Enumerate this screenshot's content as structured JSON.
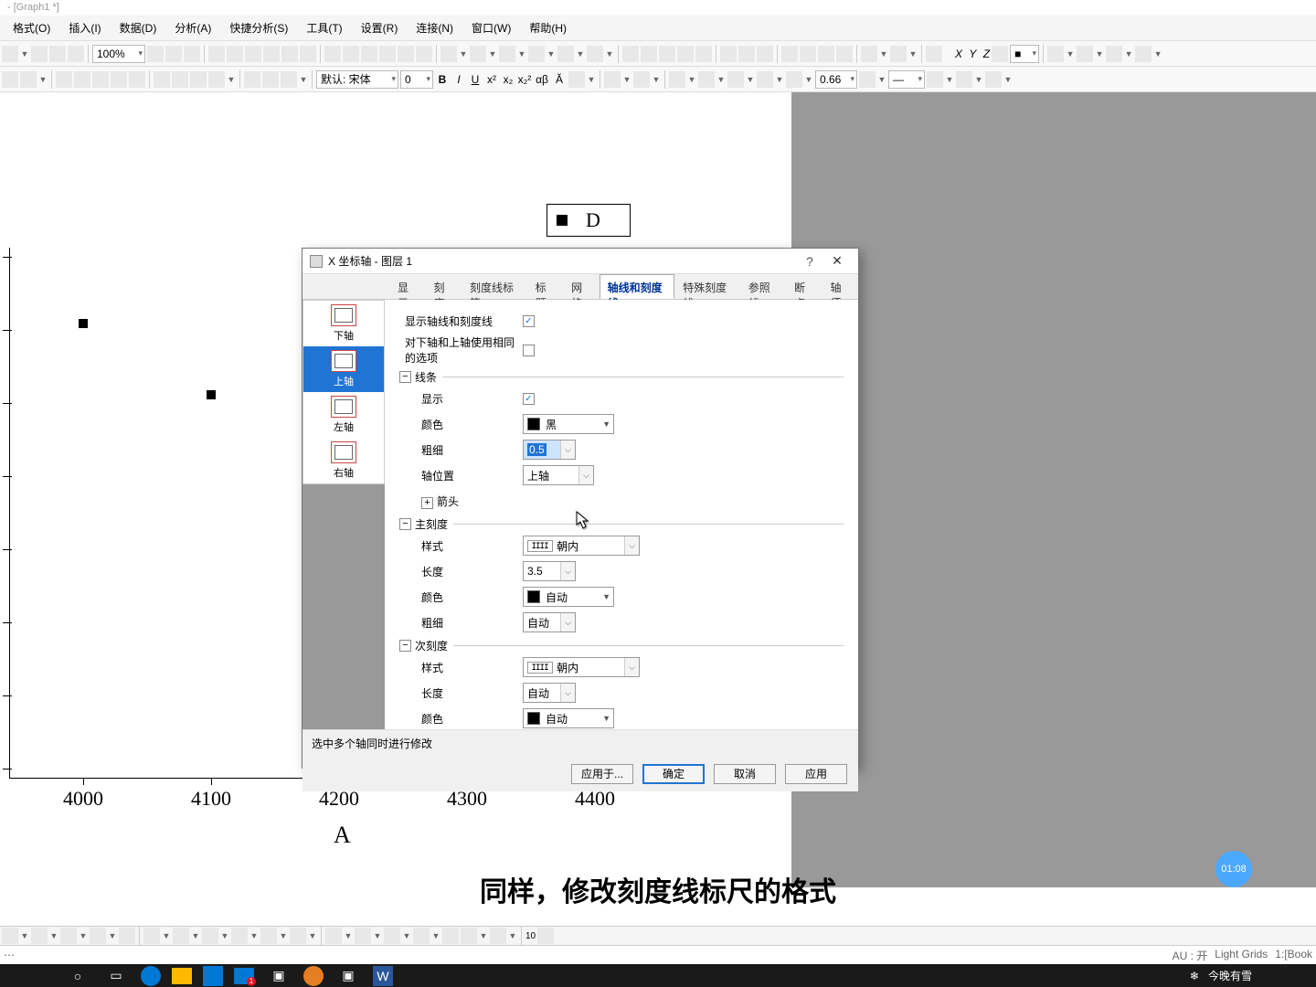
{
  "app_title": "- [Graph1 *]",
  "menus": {
    "format": "格式(O)",
    "insert": "插入(I)",
    "data": "数据(D)",
    "analysis": "分析(A)",
    "quick": "快捷分析(S)",
    "tools": "工具(T)",
    "settings": "设置(R)",
    "connect": "连接(N)",
    "window": "窗口(W)",
    "help": "帮助(H)"
  },
  "toolbar2": {
    "zoom": "100%",
    "font": "默认: 宋体",
    "fontsize": "0",
    "opacity": "0.66"
  },
  "legend": {
    "label": "D"
  },
  "chart_data": {
    "type": "scatter",
    "x": [
      4000,
      4100
    ],
    "y_visible_count": 7,
    "x_ticks": [
      "4000",
      "4100",
      "4200",
      "4300",
      "4400"
    ],
    "xlabel": "A"
  },
  "dialog": {
    "title": "X 坐标轴 - 图层 1",
    "tabs": {
      "display": "显示",
      "scale": "刻度",
      "ticklabels": "刻度线标签",
      "title": "标题",
      "grid": "网格",
      "lineticks": "轴线和刻度线",
      "special": "特殊刻度线",
      "reflines": "参照线",
      "breaks": "断点",
      "whisker": "轴须"
    },
    "axes": {
      "bottom": "下轴",
      "top": "上轴",
      "left": "左轴",
      "right": "右轴"
    },
    "labels": {
      "show_line_ticks": "显示轴线和刻度线",
      "same_options": "对下轴和上轴使用相同的选项",
      "line_section": "线条",
      "show": "显示",
      "color": "颜色",
      "thickness": "粗细",
      "axis_pos": "轴位置",
      "arrow": "箭头",
      "major_section": "主刻度",
      "style": "样式",
      "length": "长度",
      "minor_section": "次刻度"
    },
    "values": {
      "color_black": "黑",
      "thickness": "0.5",
      "axis_pos": "上轴",
      "style_in": "朝内",
      "length_major": "3.5",
      "color_auto": "自动",
      "thick_auto": "自动",
      "length_auto": "自动"
    },
    "hint": "选中多个轴同时进行修改",
    "buttons": {
      "apply_to": "应用于...",
      "ok": "确定",
      "cancel": "取消",
      "apply": "应用"
    }
  },
  "caption": "同样，修改刻度线标尺的格式",
  "time_badge": "01:08",
  "status": {
    "au": "AU : 开",
    "lightgrids": "Light Grids",
    "book": "1:[Book"
  },
  "taskbar": {
    "weather": "今晚有雪"
  }
}
